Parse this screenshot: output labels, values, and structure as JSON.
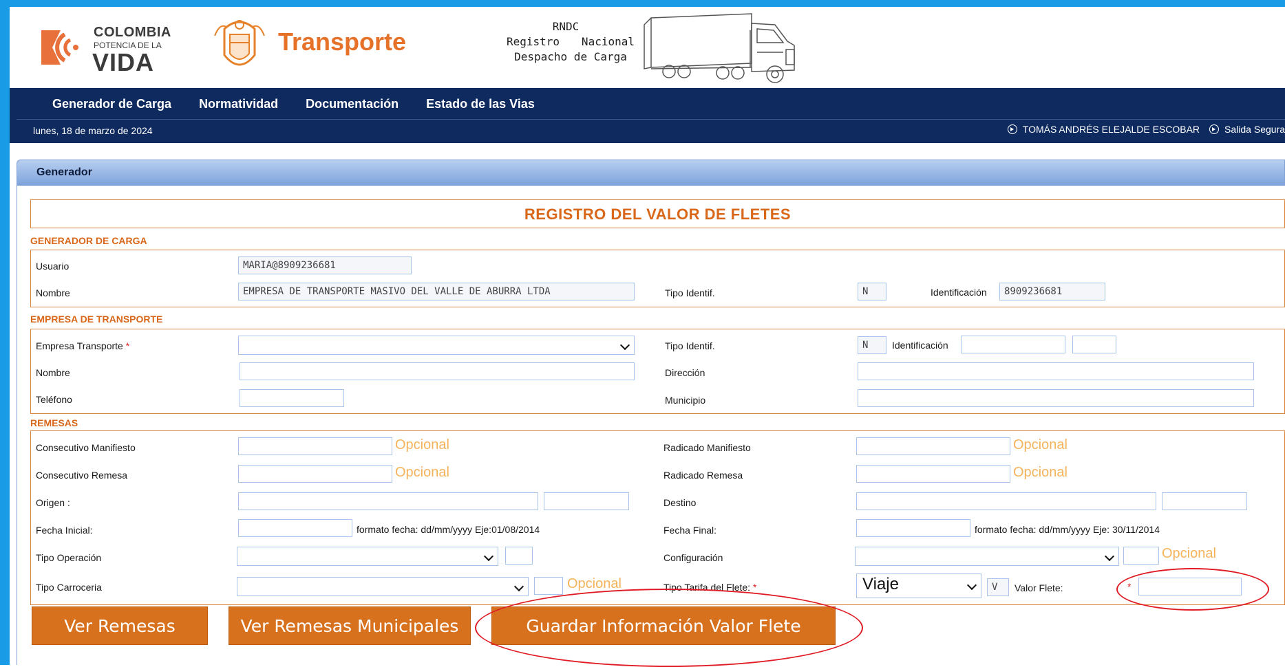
{
  "header": {
    "logo_line1": "COLOMBIA",
    "logo_line2": "POTENCIA DE LA",
    "logo_line3": "VIDA",
    "ministry_title": "Transporte",
    "rndc": "RNDC",
    "rndc_line2": "Registro Nacional",
    "rndc_line3": "Despacho de Carga"
  },
  "nav": {
    "items": [
      "Generador de Carga",
      "Normatividad",
      "Documentación",
      "Estado de las Vias"
    ],
    "date": "lunes, 18 de marzo de 2024",
    "user": "TOMÁS ANDRÉS ELEJALDE ESCOBAR",
    "logout": "Salida Segura"
  },
  "panel": {
    "title": "Generador",
    "form_title": "REGISTRO DEL VALOR DE FLETES"
  },
  "generador": {
    "section": "GENERADOR DE CARGA",
    "usuario_label": "Usuario",
    "usuario_value": "MARIA@8909236681",
    "nombre_label": "Nombre",
    "nombre_value": "EMPRESA DE TRANSPORTE MASIVO DEL VALLE DE ABURRA LTDA",
    "tipo_identif_label": "Tipo Identif.",
    "tipo_identif_value": "N",
    "identificacion_label": "Identificación",
    "identificacion_value": "8909236681"
  },
  "empresa": {
    "section": "EMPRESA DE TRANSPORTE",
    "empresa_label": "Empresa Transporte",
    "required_mark": "*",
    "tipo_identif_label": "Tipo Identif.",
    "tipo_identif_value": "N",
    "identificacion_label": "Identificación",
    "nombre_label": "Nombre",
    "direccion_label": "Dirección",
    "telefono_label": "Teléfono",
    "municipio_label": "Municipio"
  },
  "remesas": {
    "section": "REMESAS",
    "consec_manifiesto_label": "Consecutivo Manifiesto",
    "consec_remesa_label": "Consecutivo Remesa",
    "origen_label": "Origen :",
    "fecha_inicial_label": "Fecha Inicial:",
    "fecha_inicial_hint": "formato fecha: dd/mm/yyyy Eje:01/08/2014",
    "tipo_operacion_label": "Tipo Operación",
    "tipo_carroceria_label": "Tipo Carroceria",
    "radicado_manifiesto_label": "Radicado Manifiesto",
    "radicado_remesa_label": "Radicado Remesa",
    "destino_label": "Destino",
    "fecha_final_label": "Fecha Final:",
    "fecha_final_hint": "formato fecha: dd/mm/yyyy Eje: 30/11/2014",
    "configuracion_label": "Configuración",
    "tipo_tarifa_label": "Tipo Tarifa del Flete:",
    "tipo_tarifa_value": "Viaje",
    "tipo_tarifa_code": "V",
    "valor_flete_label": "Valor Flete:",
    "required_mark": "*",
    "optional": "Opcional"
  },
  "buttons": {
    "ver_remesas": "Ver Remesas",
    "ver_municipales": "Ver Remesas Municipales",
    "guardar": "Guardar Información Valor Flete"
  },
  "colors": {
    "frame": "#1a9be6",
    "nav": "#0e2a5e",
    "accent": "#d9671a",
    "annotation": "#e01b24"
  }
}
